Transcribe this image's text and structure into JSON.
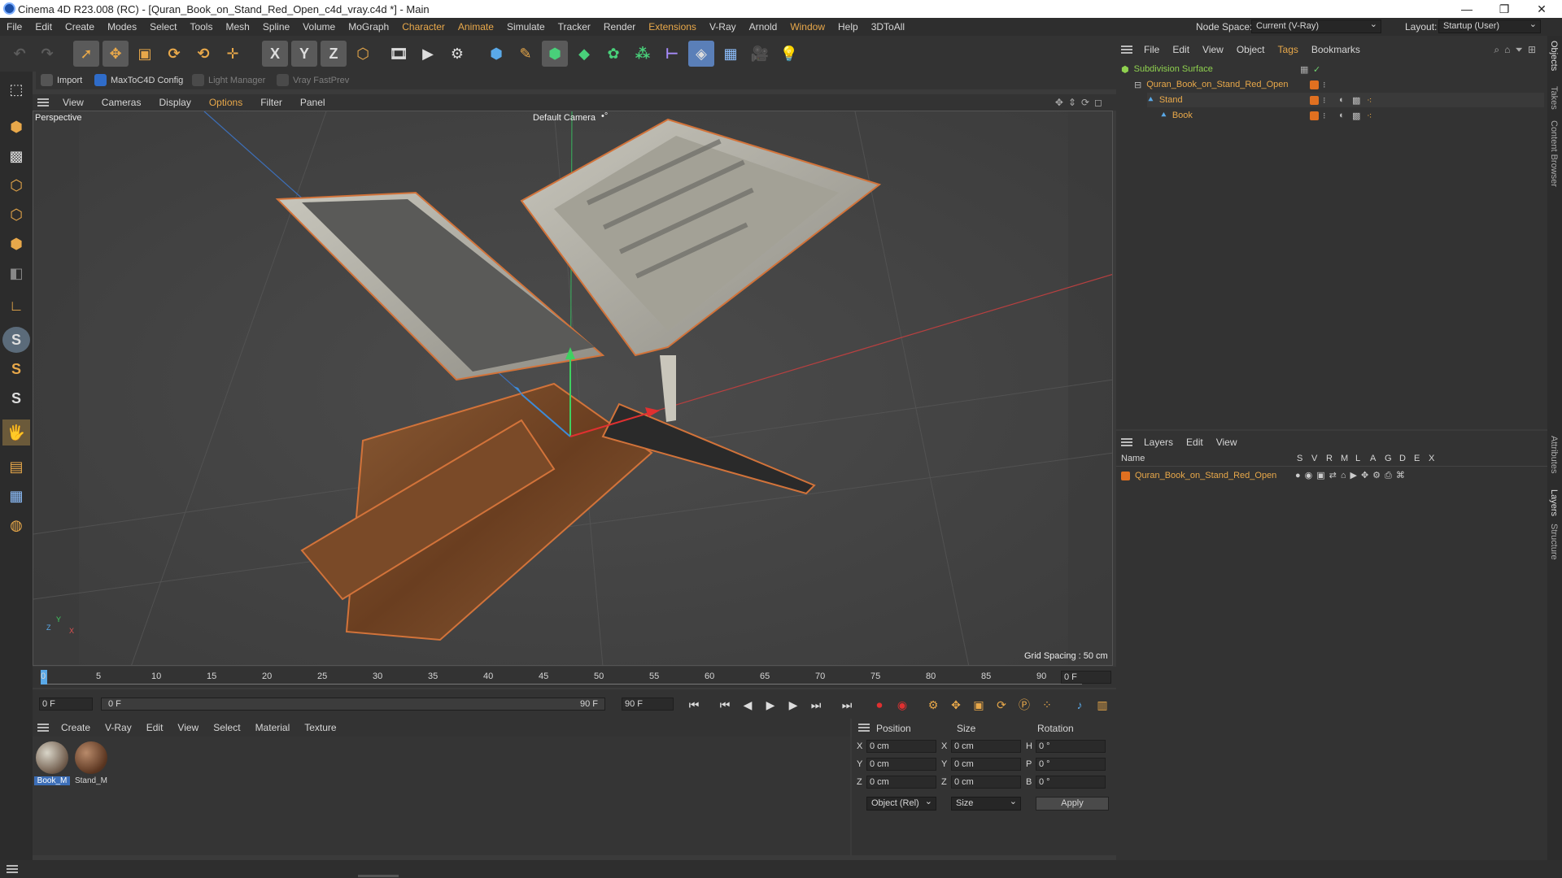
{
  "window": {
    "title": "Cinema 4D R23.008 (RC) - [Quran_Book_on_Stand_Red_Open_c4d_vray.c4d *] - Main",
    "controls": [
      "—",
      "❐",
      "✕"
    ]
  },
  "menubar": {
    "items": [
      "File",
      "Edit",
      "Create",
      "Modes",
      "Select",
      "Tools",
      "Mesh",
      "Spline",
      "Volume",
      "MoGraph",
      "Character",
      "Animate",
      "Simulate",
      "Tracker",
      "Render",
      "Extensions",
      "V-Ray",
      "Arnold",
      "Window",
      "Help",
      "3DToAll"
    ],
    "node_space_label": "Node Space:",
    "node_space_value": "Current (V-Ray)",
    "layout_label": "Layout:",
    "layout_value": "Startup (User)"
  },
  "subbar": {
    "import": "Import",
    "maxtoc4d": "MaxToC4D Config",
    "light_manager": "Light Manager",
    "vray_fastprev": "Vray FastPrev"
  },
  "toolbar": {
    "axis_x": "X",
    "axis_y": "Y",
    "axis_z": "Z"
  },
  "left_tools": {
    "s1": "S",
    "s2": "S",
    "s3": "S"
  },
  "viewport_menu": [
    "View",
    "Cameras",
    "Display",
    "Options",
    "Filter",
    "Panel"
  ],
  "viewport": {
    "label": "Perspective",
    "camera": "Default Camera",
    "camera_icon": "•°",
    "grid_spacing": "Grid Spacing : 50 cm",
    "axis_labels": {
      "x": "X",
      "y": "Y",
      "z": "Z"
    }
  },
  "timeline": {
    "ticks": [
      "0",
      "5",
      "10",
      "15",
      "20",
      "25",
      "30",
      "35",
      "40",
      "45",
      "50",
      "55",
      "60",
      "65",
      "70",
      "75",
      "80",
      "85",
      "90"
    ],
    "current_frame": "0 F"
  },
  "playback": {
    "start_frame": "0 F",
    "range_start": "0 F",
    "range_end": "90 F",
    "end_frame": "90 F"
  },
  "material_menu": [
    "Create",
    "V-Ray",
    "Edit",
    "View",
    "Select",
    "Material",
    "Texture"
  ],
  "materials": [
    {
      "name": "Book_M",
      "selected": true
    },
    {
      "name": "Stand_M",
      "selected": false
    }
  ],
  "coords": {
    "position_label": "Position",
    "size_label": "Size",
    "rotation_label": "Rotation",
    "rows": [
      {
        "axis": "X",
        "pos": "0 cm",
        "size_axis": "X",
        "size": "0 cm",
        "rot_axis": "H",
        "rot": "0 °"
      },
      {
        "axis": "Y",
        "pos": "0 cm",
        "size_axis": "Y",
        "size": "0 cm",
        "rot_axis": "P",
        "rot": "0 °"
      },
      {
        "axis": "Z",
        "pos": "0 cm",
        "size_axis": "Z",
        "size": "0 cm",
        "rot_axis": "B",
        "rot": "0 °"
      }
    ],
    "mode": "Object (Rel)",
    "size_mode": "Size",
    "apply": "Apply"
  },
  "objects_panel": {
    "menu": [
      "File",
      "Edit",
      "View",
      "Object",
      "Tags",
      "Bookmarks"
    ],
    "tree": [
      {
        "name": "Subdivision Surface",
        "level": 0,
        "color": "#8fd14f"
      },
      {
        "name": "Quran_Book_on_Stand_Red_Open",
        "level": 1,
        "color": "#e8a84a"
      },
      {
        "name": "Stand",
        "level": 2,
        "color": "#e8a84a"
      },
      {
        "name": "Book",
        "level": 3,
        "color": "#e8a84a"
      }
    ]
  },
  "layers_panel": {
    "menu": [
      "Layers",
      "Edit",
      "View"
    ],
    "columns": [
      "Name",
      "S",
      "V",
      "R",
      "M",
      "L",
      "A",
      "G",
      "D",
      "E",
      "X"
    ],
    "rows": [
      {
        "name": "Quran_Book_on_Stand_Red_Open",
        "color": "#e07020"
      }
    ]
  },
  "right_tabs": [
    "Objects",
    "Takes",
    "Content Browser",
    "Attributes",
    "Layers",
    "Structure"
  ],
  "colors": {
    "accent": "#e8a84a",
    "background": "#3b3b3b",
    "viewport": "#474747",
    "selection_blue": "#3d8bd8"
  }
}
